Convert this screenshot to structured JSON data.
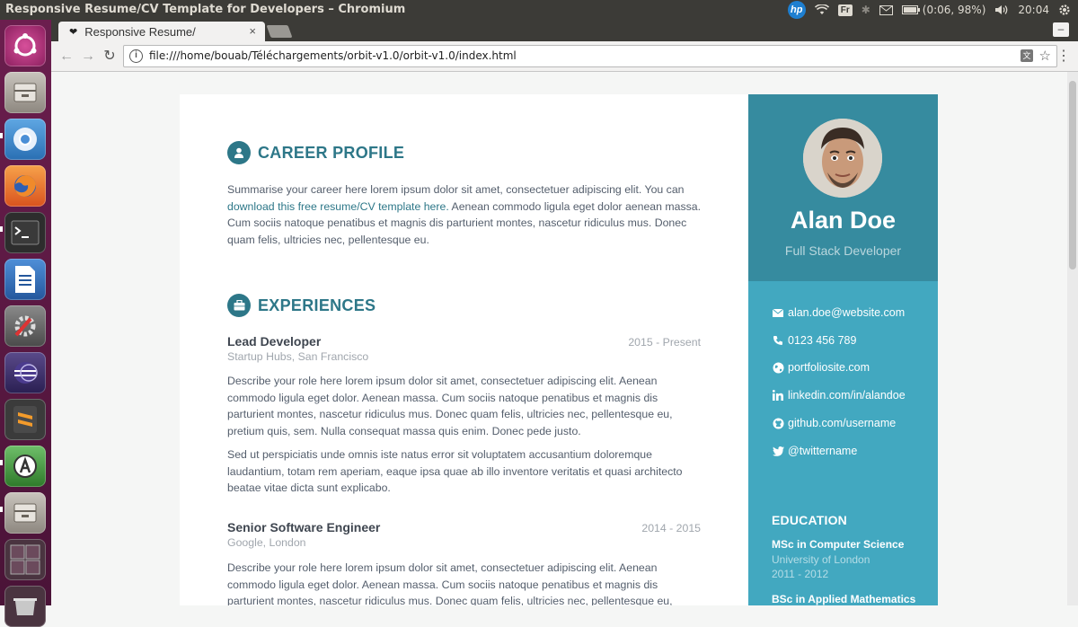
{
  "system": {
    "window_title": "Responsive Resume/CV Template for Developers – Chromium",
    "keyboard_layout": "Fr",
    "battery": "(0:06, 98%)",
    "clock": "20:04"
  },
  "launcher": {
    "items": [
      "ubuntu-dash",
      "files",
      "chromium",
      "firefox",
      "terminal",
      "libreoffice-writer",
      "system-settings",
      "eclipse",
      "sublime-text",
      "software-updater",
      "files-2",
      "workspace-switcher",
      "trash"
    ]
  },
  "browser": {
    "tab_title": "Responsive Resume/",
    "tab_close": "×",
    "url": "file:///home/bouab/Téléchargements/orbit-v1.0/orbit-v1.0/index.html"
  },
  "resume": {
    "career_profile": {
      "heading": "CAREER PROFILE",
      "text_before": "Summarise your career here lorem ipsum dolor sit amet, consectetuer adipiscing elit. You can ",
      "link": "download this free resume/CV template here.",
      "text_after": " Aenean commodo ligula eget dolor aenean massa. Cum sociis natoque penatibus et magnis dis parturient montes, nascetur ridiculus mus. Donec quam felis, ultricies nec, pellentesque eu."
    },
    "experiences": {
      "heading": "EXPERIENCES",
      "jobs": [
        {
          "title": "Lead Developer",
          "time": "2015 - Present",
          "company": "Startup Hubs, San Francisco",
          "para1": "Describe your role here lorem ipsum dolor sit amet, consectetuer adipiscing elit. Aenean commodo ligula eget dolor. Aenean massa. Cum sociis natoque penatibus et magnis dis parturient montes, nascetur ridiculus mus. Donec quam felis, ultricies nec, pellentesque eu, pretium quis, sem. Nulla consequat massa quis enim. Donec pede justo.",
          "para2": "Sed ut perspiciatis unde omnis iste natus error sit voluptatem accusantium doloremque laudantium, totam rem aperiam, eaque ipsa quae ab illo inventore veritatis et quasi architecto beatae vitae dicta sunt explicabo."
        },
        {
          "title": "Senior Software Engineer",
          "time": "2014 - 2015",
          "company": "Google, London",
          "para1": "Describe your role here lorem ipsum dolor sit amet, consectetuer adipiscing elit. Aenean commodo ligula eget dolor. Aenean massa. Cum sociis natoque penatibus et magnis dis parturient montes, nascetur ridiculus mus. Donec quam felis, ultricies nec, pellentesque eu,"
        }
      ]
    },
    "sidebar": {
      "name": "Alan Doe",
      "tagline": "Full Stack Developer",
      "contacts": {
        "email": "alan.doe@website.com",
        "phone": "0123 456 789",
        "website": "portfoliosite.com",
        "linkedin": "linkedin.com/in/alandoe",
        "github": "github.com/username",
        "twitter": "@twittername"
      },
      "education": {
        "heading": "EDUCATION",
        "items": [
          {
            "degree": "MSc in Computer Science",
            "school": "University of London",
            "years": "2011 - 2012"
          },
          {
            "degree": "BSc in Applied Mathematics"
          }
        ]
      }
    }
  },
  "colors": {
    "accent": "#2d7788",
    "sidebar": "#42a8c0",
    "sidebar_header": "#368b9f",
    "launcher": "#5e1a45"
  }
}
